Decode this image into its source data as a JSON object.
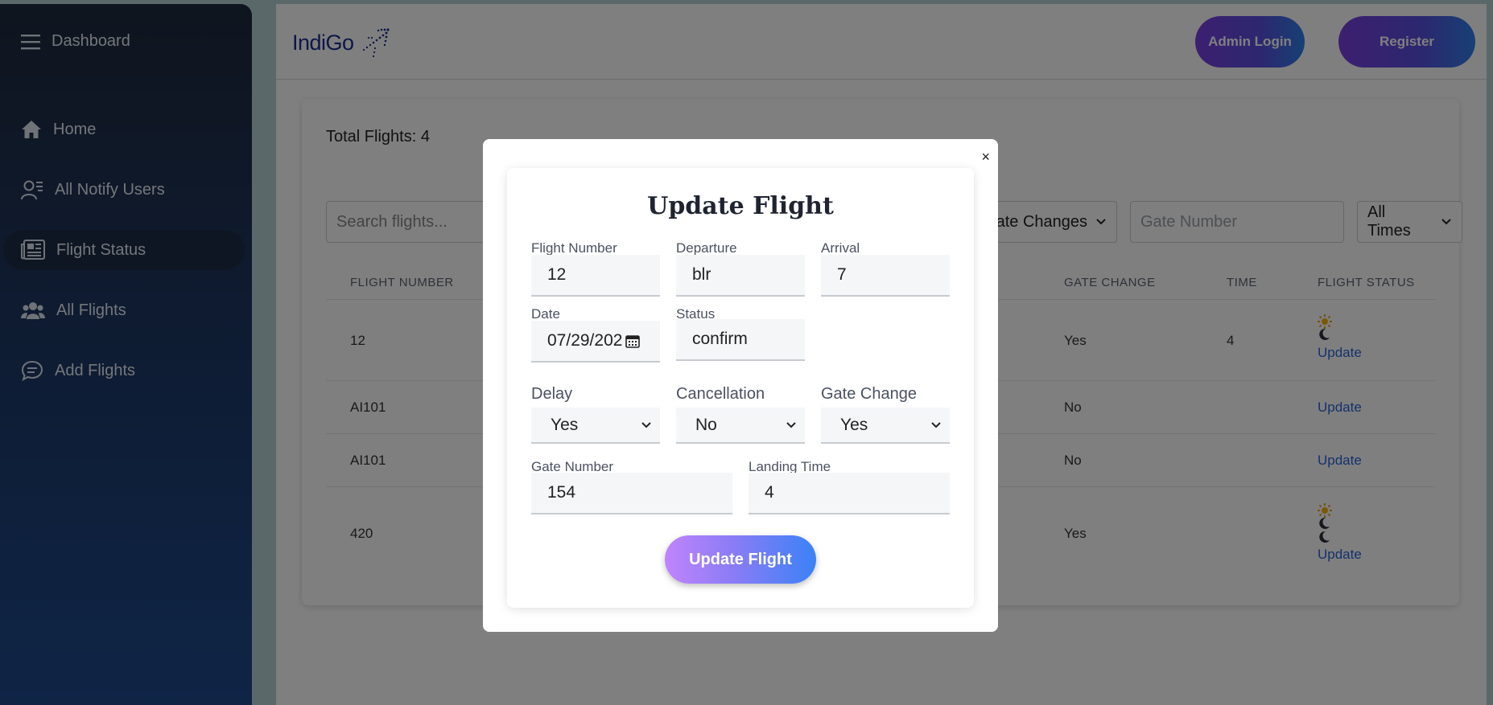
{
  "sidebar": {
    "title": "Dashboard",
    "items": [
      {
        "label": "Home",
        "icon": "home-icon"
      },
      {
        "label": "All Notify Users",
        "icon": "user-list-icon"
      },
      {
        "label": "Flight Status",
        "icon": "newspaper-icon",
        "active": true
      },
      {
        "label": "All Flights",
        "icon": "users-icon"
      },
      {
        "label": "Add Flights",
        "icon": "chat-icon"
      }
    ]
  },
  "header": {
    "logo_text": "IndiGo",
    "admin_login_label": "Admin Login",
    "register_label": "Register"
  },
  "main": {
    "total_flights": "Total Flights: 4",
    "search_placeholder": "Search flights...",
    "gate_changes_filter": "ate Changes",
    "gate_number_placeholder": "Gate Number",
    "time_filter": "All Times",
    "columns": {
      "flight_number": "FLIGHT NUMBER",
      "gate_change": "GATE CHANGE",
      "time": "TIME",
      "flight_status": "FLIGHT STATUS"
    },
    "rows": [
      {
        "flight_number": "12",
        "gate_change": "Yes",
        "time": "4",
        "action": "Update"
      },
      {
        "flight_number": "AI101",
        "gate_change": "No",
        "time": "",
        "action": "Update"
      },
      {
        "flight_number": "AI101",
        "gate_change": "No",
        "time": "",
        "action": "Update"
      },
      {
        "flight_number": "420",
        "gate_change": "Yes",
        "time": "",
        "action": "Update"
      }
    ]
  },
  "modal": {
    "close_symbol": "×",
    "title": "Update Flight",
    "fields": {
      "flight_number": {
        "label": "Flight Number",
        "value": "12"
      },
      "departure": {
        "label": "Departure",
        "value": "blr"
      },
      "arrival": {
        "label": "Arrival",
        "value": "7"
      },
      "date": {
        "label": "Date",
        "value": "07/29/202"
      },
      "status": {
        "label": "Status",
        "value": "confirm"
      },
      "delay": {
        "label": "Delay",
        "value": "Yes"
      },
      "cancellation": {
        "label": "Cancellation",
        "value": "No"
      },
      "gate_change": {
        "label": "Gate Change",
        "value": "Yes"
      },
      "gate_number": {
        "label": "Gate Number",
        "value": "154"
      },
      "landing_time": {
        "label": "Landing Time",
        "value": "4"
      }
    },
    "submit_label": "Update Flight"
  },
  "colors": {
    "sidebar_top": "#1f2a3d",
    "sidebar_bottom": "#1e4a8d",
    "link": "#2b63d9",
    "button_gradient_start": "#7a3fe0",
    "button_gradient_end": "#2f7fe8"
  }
}
